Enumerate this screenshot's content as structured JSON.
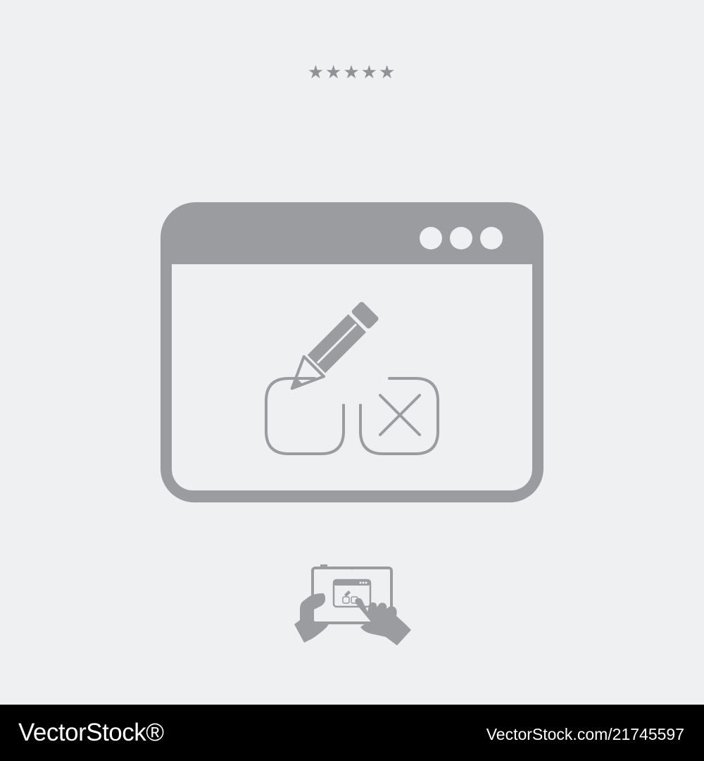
{
  "rating": {
    "stars": "★★★★★",
    "value": 5,
    "max": 5
  },
  "icons": {
    "main": "browser-window-edit-delete-icon",
    "window_menu": "three-dots-icon",
    "pencil": "pencil-icon",
    "checkbox_empty": "checkbox-empty-icon",
    "checkbox_cross": "checkbox-cross-icon",
    "tablet_hands": "tablet-touch-hands-icon"
  },
  "colors": {
    "background": "#eef0f2",
    "icon": "#9a9ca0",
    "footer": "#000000",
    "footer_text": "#ffffff"
  },
  "footer": {
    "logo": "VectorStock®",
    "image_id": "VectorStock.com/21745597"
  }
}
